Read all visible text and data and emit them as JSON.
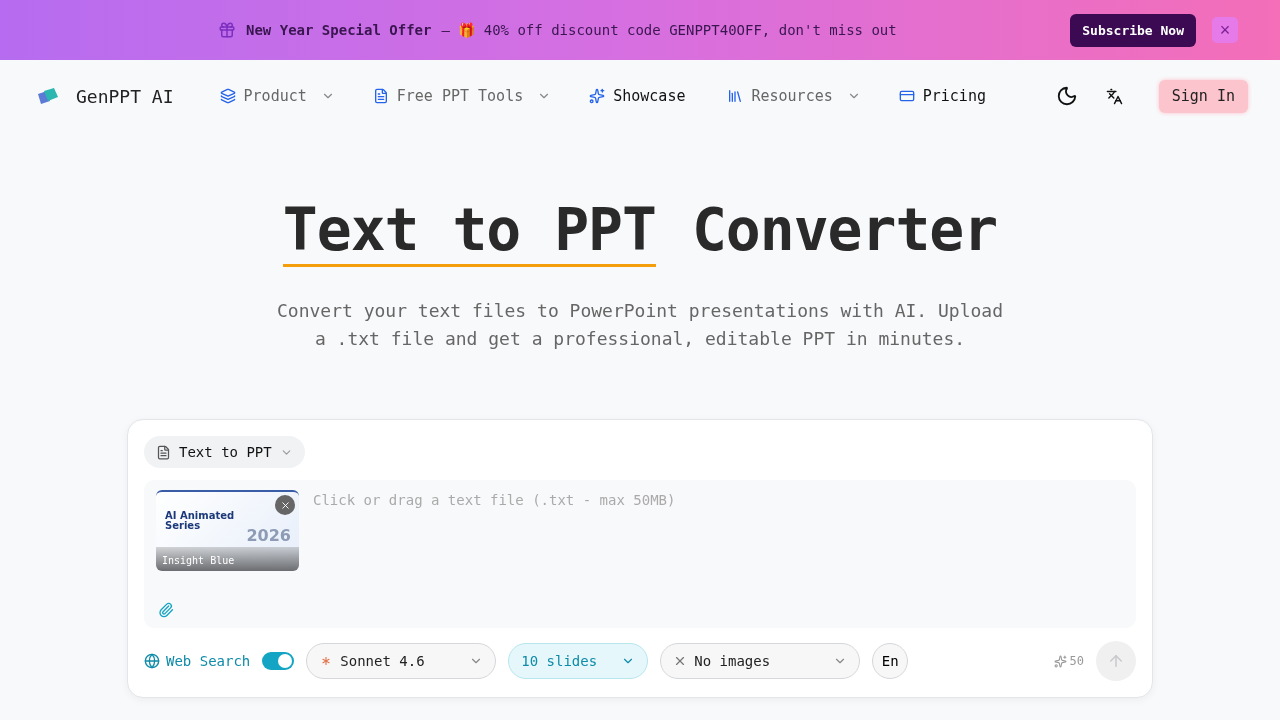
{
  "banner": {
    "title": "New Year Special Offer",
    "text": "— 🎁 40% off discount code GENPPT40OFF, don't miss out",
    "button": "Subscribe Now",
    "close": "×"
  },
  "nav": {
    "brand": "GenPPT AI",
    "items": [
      {
        "label": "Product",
        "kind": "menu"
      },
      {
        "label": "Free PPT Tools",
        "kind": "menu"
      },
      {
        "label": "Showcase",
        "kind": "link"
      },
      {
        "label": "Resources",
        "kind": "menu"
      },
      {
        "label": "Pricing",
        "kind": "link"
      }
    ],
    "sign_in": "Sign In"
  },
  "hero": {
    "title_highlight": "Text to PPT",
    "title_rest": "Converter",
    "subtitle": "Convert your text files to PowerPoint presentations with AI. Upload a .txt file and get a professional, editable PPT in minutes."
  },
  "composer": {
    "mode": "Text to PPT",
    "placeholder": "Click or drag a text file (.txt - max 50MB)",
    "template": {
      "slide_title": "AI Animated Series",
      "slide_year": "2026",
      "name": "Insight Blue"
    },
    "web_search": {
      "label": "Web Search",
      "on": true
    },
    "model": "Sonnet 4.6",
    "slides": "10 slides",
    "images": "No images",
    "language": "En",
    "credits": "50"
  }
}
